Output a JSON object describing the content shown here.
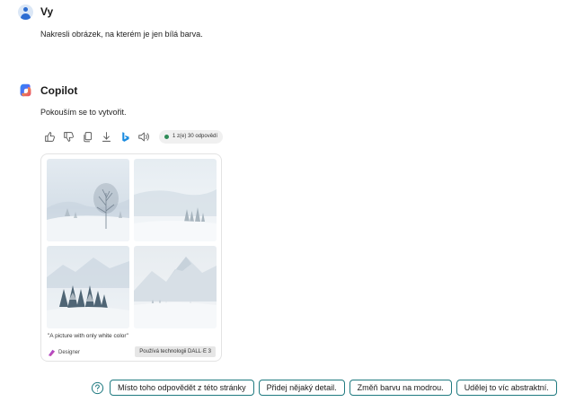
{
  "user": {
    "name": "Vy",
    "message": "Nakresli obrázek, na kterém je jen bílá barva."
  },
  "copilot": {
    "name": "Copilot",
    "message": "Pokouším se to vytvořit.",
    "actions": [
      "thumbs-up-icon",
      "thumbs-down-icon",
      "copy-icon",
      "download-icon",
      "bing-icon",
      "speaker-icon"
    ],
    "response_counter": "1 z(e) 30 odpovědí"
  },
  "image_card": {
    "caption": "\"A picture with only white color\"",
    "designer_label": "Designer",
    "dalle_tag": "Používá technologii DALL·E 3"
  },
  "suggestions": [
    "Místo toho odpovědět z této stránky",
    "Přidej nějaký detail.",
    "Změň barvu na modrou.",
    "Udělej to víc abstraktní."
  ],
  "colors": {
    "accent": "#1f7a80",
    "user_icon": "#2d6dd2",
    "status_dot": "#2e8b57"
  }
}
